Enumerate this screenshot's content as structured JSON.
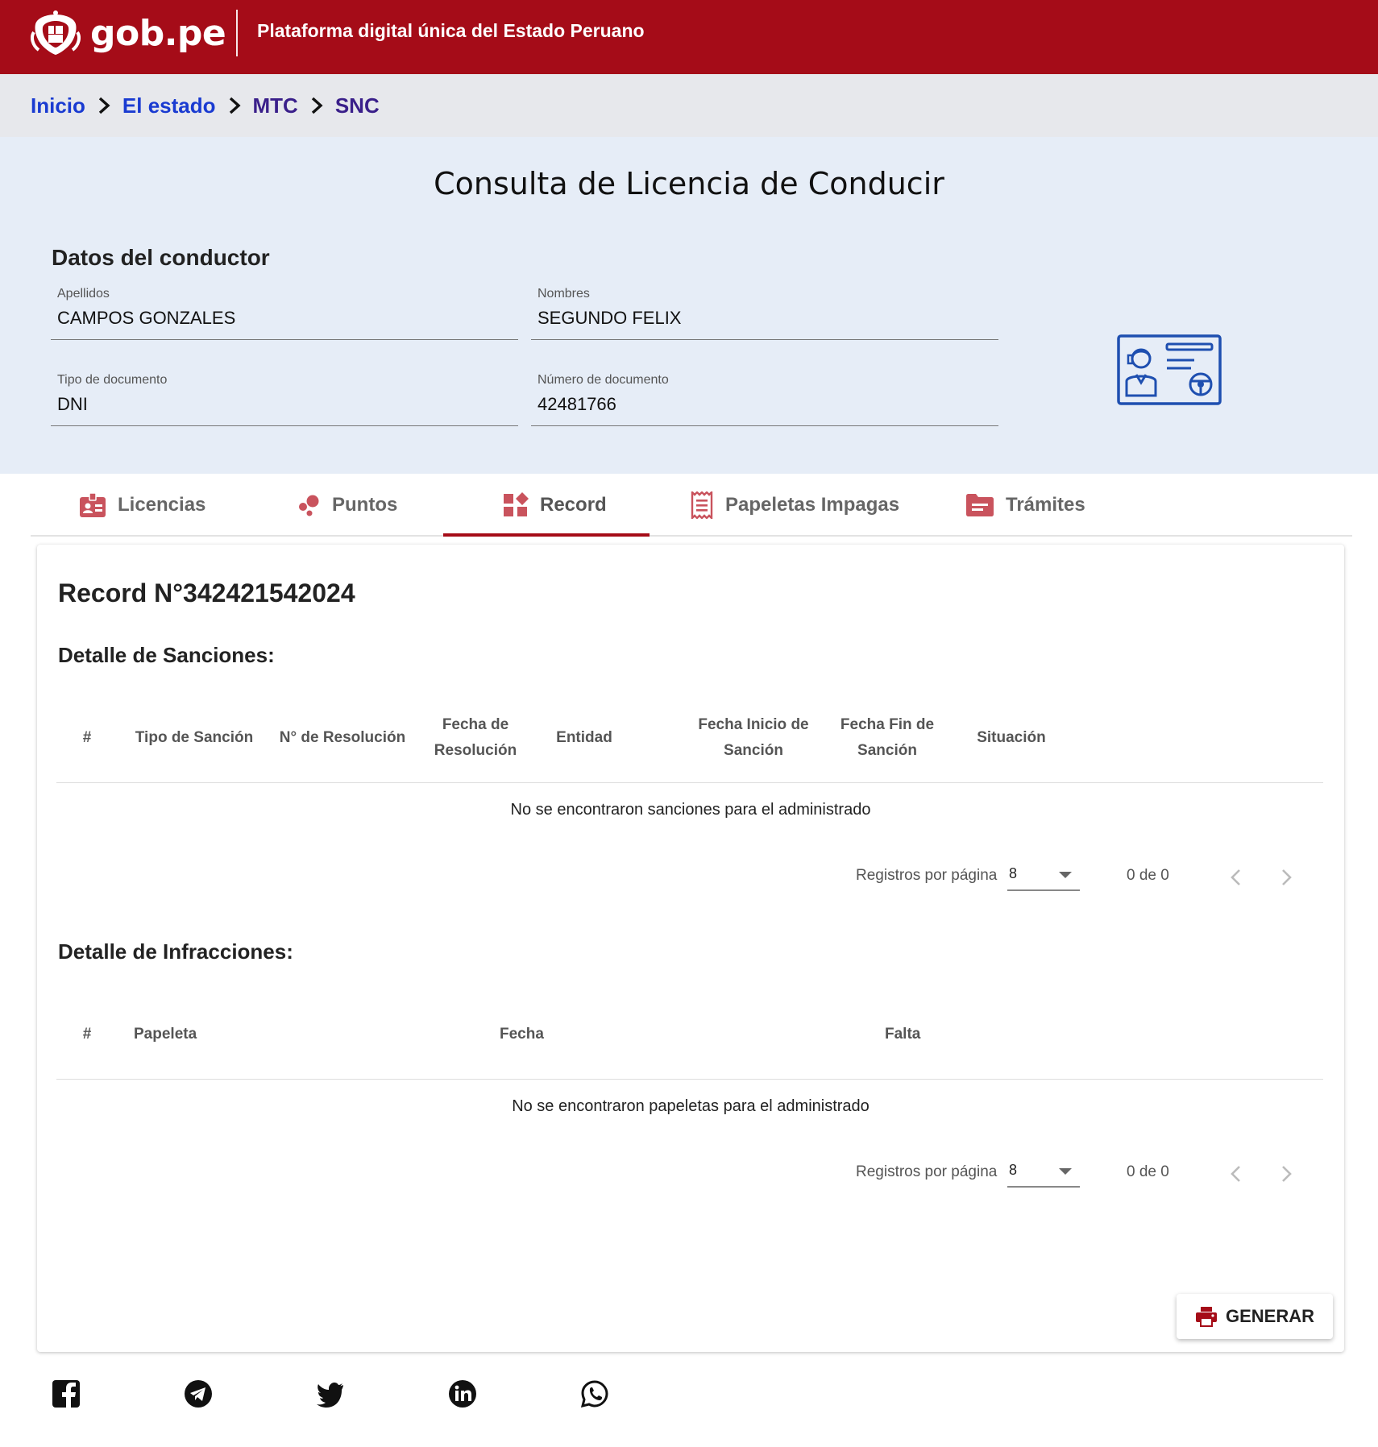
{
  "header": {
    "logo_text": "gob.pe",
    "slogan": "Plataforma digital única del Estado Peruano"
  },
  "breadcrumb": [
    "Inicio",
    "El estado",
    "MTC",
    "SNC"
  ],
  "page": {
    "title": "Consulta de Licencia de Conducir"
  },
  "driver": {
    "section_title": "Datos del conductor",
    "fields": [
      {
        "label": "Apellidos",
        "value": "CAMPOS GONZALES"
      },
      {
        "label": "Nombres",
        "value": "SEGUNDO FELIX"
      },
      {
        "label": "Tipo de documento",
        "value": "DNI"
      },
      {
        "label": "Número de documento",
        "value": "42481766"
      }
    ]
  },
  "tabs": [
    {
      "label": "Licencias",
      "icon": "badge-icon"
    },
    {
      "label": "Puntos",
      "icon": "bubbles-icon"
    },
    {
      "label": "Record",
      "icon": "widgets-icon",
      "active": true
    },
    {
      "label": "Papeletas Impagas",
      "icon": "receipt-icon"
    },
    {
      "label": "Trámites",
      "icon": "folder-icon"
    }
  ],
  "record": {
    "title": "Record N°342421542024",
    "sanciones": {
      "title": "Detalle de Sanciones:",
      "columns": [
        "#",
        "Tipo de Sanción",
        "N° de Resolución",
        "Fecha de Resolución",
        "Entidad",
        "Fecha Inicio de Sanción",
        "Fecha Fin de Sanción",
        "Situación"
      ],
      "empty_message": "No se encontraron sanciones para el administrado",
      "pager": {
        "label": "Registros por página",
        "page_size": "8",
        "range": "0 de 0"
      }
    },
    "infracciones": {
      "title": "Detalle de Infracciones:",
      "columns": [
        "#",
        "Papeleta",
        "Fecha",
        "Falta"
      ],
      "empty_message": "No se encontraron papeletas para el administrado",
      "pager": {
        "label": "Registros por página",
        "page_size": "8",
        "range": "0 de 0"
      }
    },
    "generate_label": "GENERAR"
  },
  "social": [
    "facebook-icon",
    "telegram-icon",
    "twitter-icon",
    "linkedin-icon",
    "whatsapp-icon"
  ],
  "colors": {
    "brand": "#a50c18",
    "link": "#1a3bd1",
    "section_bg": "#e6edf7",
    "tab_icon": "#c9535d",
    "illustration": "#1e4fb0"
  }
}
